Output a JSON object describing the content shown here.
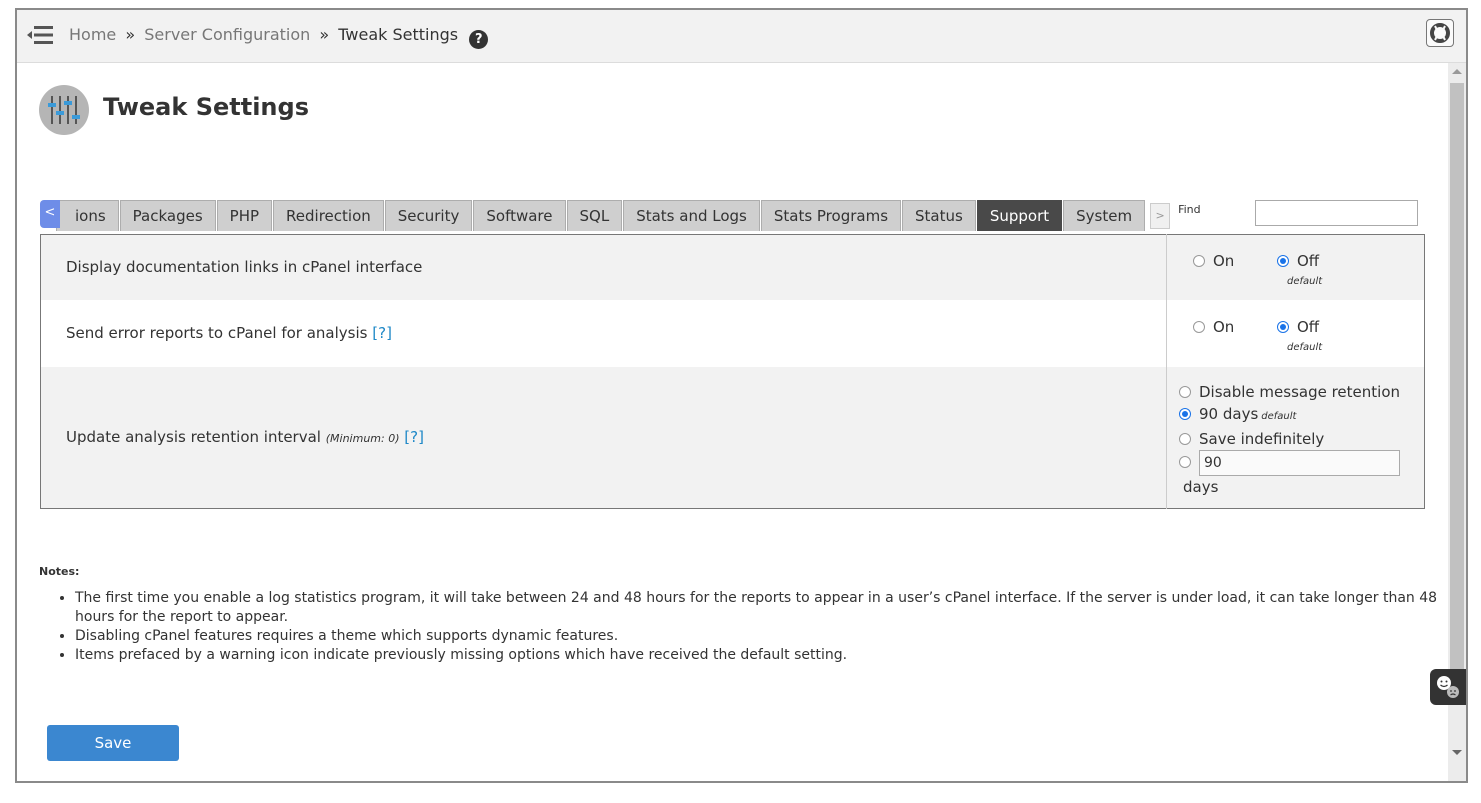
{
  "breadcrumb": {
    "home": "Home",
    "section": "Server Configuration",
    "current": "Tweak Settings",
    "separator": "»"
  },
  "page": {
    "title": "Tweak Settings"
  },
  "tabs": {
    "prev_label": "<",
    "next_label": ">",
    "items": [
      "ions",
      "Packages",
      "PHP",
      "Redirection",
      "Security",
      "Software",
      "SQL",
      "Stats and Logs",
      "Stats Programs",
      "Status",
      "Support",
      "System"
    ],
    "active": "Support",
    "find_label": "Find",
    "find_value": ""
  },
  "settings": [
    {
      "label": "Display documentation links in cPanel interface",
      "on": "On",
      "off": "Off",
      "selected": "Off",
      "default_note": "default"
    },
    {
      "label": "Send error reports to cPanel for analysis",
      "help": "[?]",
      "on": "On",
      "off": "Off",
      "selected": "Off",
      "default_note": "default"
    },
    {
      "label": "Update analysis retention interval",
      "minimum": "(Minimum: 0)",
      "help": "[?]",
      "options": [
        "Disable message retention",
        "90 days",
        "Save indefinitely"
      ],
      "selected": "90 days",
      "default_note": "default",
      "custom_value": "90",
      "custom_unit": "days"
    }
  ],
  "notes": {
    "title": "Notes:",
    "items": [
      "The first time you enable a log statistics program, it will take between 24 and 48 hours for the reports to appear in a user’s cPanel interface. If the server is under load, it can take longer than 48 hours for the report to appear.",
      "Disabling cPanel features requires a theme which supports dynamic features.",
      "Items prefaced by a warning icon indicate previously missing options which have received the default setting."
    ]
  },
  "save_label": "Save",
  "icons": {
    "menu": "menu-collapse-icon",
    "help": "question-circle-icon",
    "support": "lifebuoy-icon",
    "page": "sliders-icon",
    "chat": "feedback-faces-icon"
  },
  "colors": {
    "active_tab": "#494949",
    "link": "#1e88c7",
    "save_button": "#3b87d0",
    "radio_checked": "#1a73e8",
    "tab_prev": "#6e8de8"
  }
}
